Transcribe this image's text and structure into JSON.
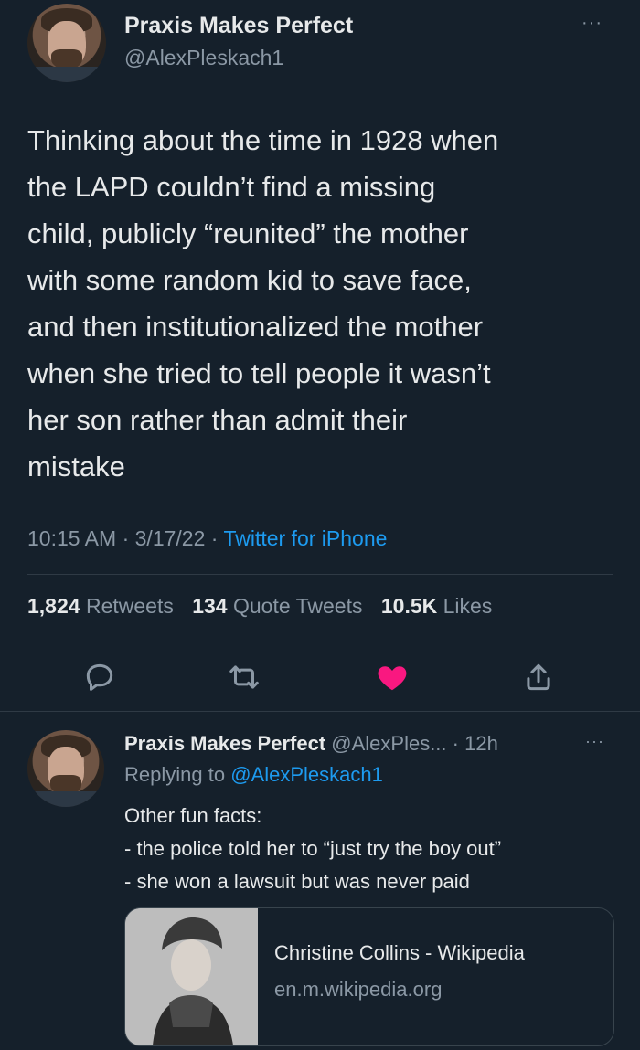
{
  "main_tweet": {
    "author": {
      "name": "Praxis Makes Perfect",
      "handle": "@AlexPleskach1"
    },
    "more_label": "···",
    "text_lines": [
      "Thinking about the time in 1928 when",
      "the LAPD couldn’t find a missing",
      "child, publicly “reunited” the mother",
      "with some random kid to save face,",
      "and then institutionalized the mother",
      "when she tried to tell people it wasn’t",
      "her son rather than admit their",
      "mistake"
    ],
    "time": "10:15 AM",
    "date": "3/17/22",
    "source": "Twitter for iPhone",
    "sep": "·",
    "stats": {
      "retweets_count": "1,824",
      "retweets_label": "Retweets",
      "quotes_count": "134",
      "quotes_label": "Quote Tweets",
      "likes_count": "10.5K",
      "likes_label": "Likes"
    },
    "icons": [
      "reply-icon",
      "retweet-icon",
      "like-icon",
      "share-icon"
    ],
    "like_color": "#f91880"
  },
  "reply_tweet": {
    "author": {
      "name": "Praxis Makes Perfect",
      "handle": "@AlexPles...",
      "age": "· 12h"
    },
    "more_label": "···",
    "replying_prefix": "Replying to",
    "replying_handle": "@AlexPleskach1",
    "lines": [
      "Other fun facts:",
      "- the police told her to “just try the boy out”",
      "- she won a lawsuit but was never paid"
    ],
    "link_card": {
      "title": "Christine Collins - Wikipedia",
      "domain": "en.m.wikipedia.org"
    }
  },
  "colors": {
    "background": "#15202b",
    "text": "#e7e9ea",
    "muted": "#8b98a5",
    "accent": "#1d9bf0"
  }
}
